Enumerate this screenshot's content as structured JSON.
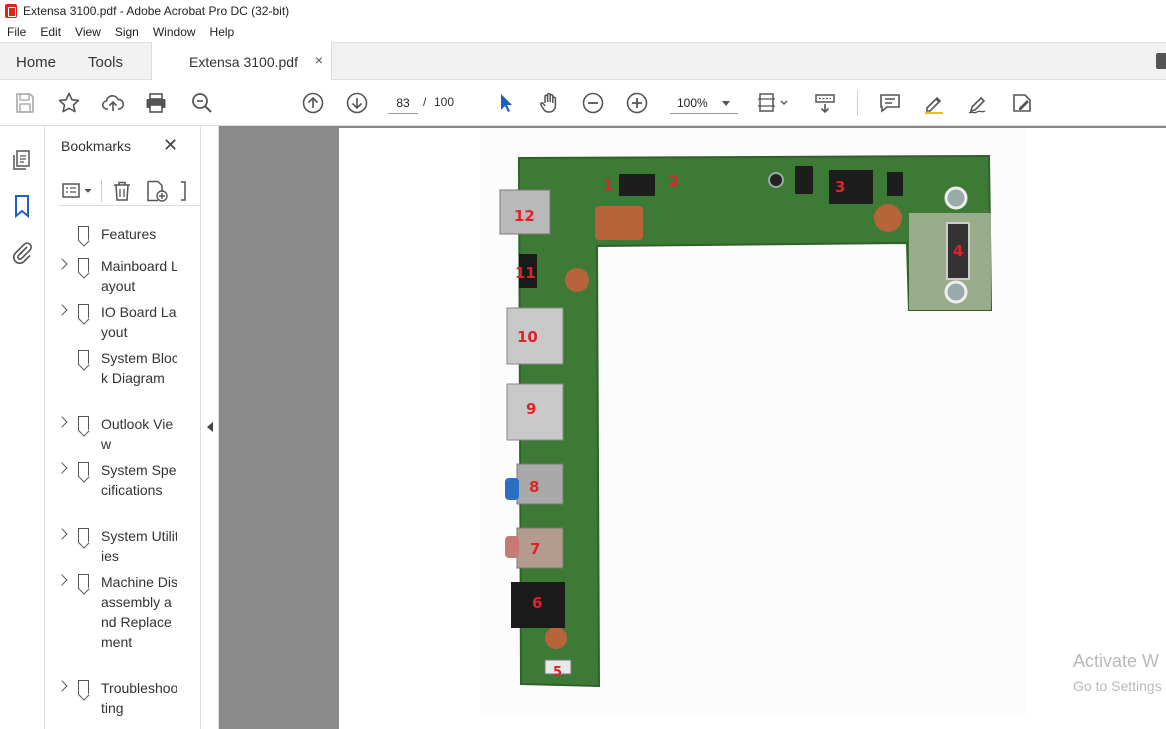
{
  "window": {
    "title": "Extensa 3100.pdf - Adobe Acrobat Pro DC (32-bit)"
  },
  "menu": [
    "File",
    "Edit",
    "View",
    "Sign",
    "Window",
    "Help"
  ],
  "tabs": {
    "home": "Home",
    "tools": "Tools",
    "document": "Extensa 3100.pdf",
    "close": "×"
  },
  "toolbar": {
    "page_current": "83",
    "page_sep": "/",
    "page_total": "100",
    "zoom": "100%"
  },
  "bookmarks": {
    "title": "Bookmarks",
    "close": "✕",
    "items": [
      {
        "label": "Features",
        "expandable": false
      },
      {
        "label": "Mainboard Layout",
        "expandable": true
      },
      {
        "label": "IO Board Layout",
        "expandable": true
      },
      {
        "label": "System Block Diagram",
        "expandable": false
      },
      {
        "label": "Outlook View",
        "expandable": true
      },
      {
        "label": "System Specifications",
        "expandable": true
      },
      {
        "label": "System Utilities",
        "expandable": true
      },
      {
        "label": "Machine Disassembly and Replacement",
        "expandable": true
      },
      {
        "label": "Troubleshooting",
        "expandable": true
      }
    ]
  },
  "board_labels": [
    "1",
    "2",
    "3",
    "4",
    "5",
    "6",
    "7",
    "8",
    "9",
    "10",
    "11",
    "12"
  ],
  "watermark": {
    "line1": "Activate W",
    "line2": "Go to Settings"
  },
  "colors": {
    "board": "#3d7a35",
    "board_dark": "#2f6129",
    "copper": "#b8643a",
    "label": "#e0222a",
    "accent_blue": "#2b6fc2"
  }
}
